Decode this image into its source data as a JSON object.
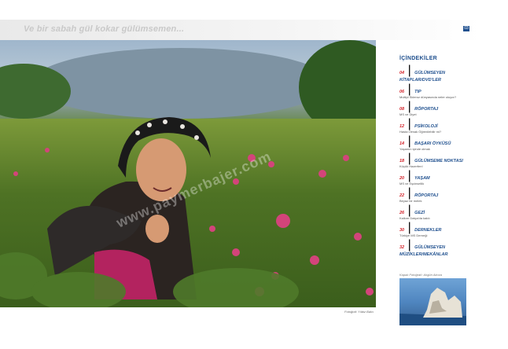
{
  "banner": {
    "title": "Ve bir sabah gül kokar gülümsemen..."
  },
  "page_number": "03",
  "photo": {
    "caption": "Fotoğraf: Yıldız Balcı",
    "watermark": "www.paymerbajer.com"
  },
  "toc": {
    "heading": "İÇİNDEKİLER",
    "items": [
      {
        "num": "04",
        "title": "GÜLÜMSEYEN KİTAPLAR/DVD'LER",
        "sub": ""
      },
      {
        "num": "06",
        "title": "TIP",
        "sub": "Multipl Skleroz dünyasında neler oluyor?"
      },
      {
        "num": "08",
        "title": "RÖPORTAJ",
        "sub": "MS ve Diyet"
      },
      {
        "num": "12",
        "title": "PSİKOLOJİ",
        "sub": "Hasta Olmak Öğrenilebilir mi?"
      },
      {
        "num": "14",
        "title": "BAŞARI ÖYKÜSÜ",
        "sub": "Yaşamın içinde olmak"
      },
      {
        "num": "18",
        "title": "GÜLÜMSEME NOKTASI",
        "sub": "Küçük Hazerfen!"
      },
      {
        "num": "20",
        "title": "YAŞAM",
        "sub": "MS ve Eşcinsellik"
      },
      {
        "num": "22",
        "title": "RÖPORTAJ",
        "sub": "Beyaz bir melek"
      },
      {
        "num": "26",
        "title": "GEZİ",
        "sub": "Kalkım Datça'da kaldı"
      },
      {
        "num": "30",
        "title": "DERNEKLER",
        "sub": "Türkiye MS Derneği"
      },
      {
        "num": "32",
        "title": "GÜLÜMSEYEN MÜZİKLER/MEKÂNLAR",
        "sub": ""
      }
    ],
    "cover_caption": "Kapak Fotoğrafı: Akgün Akova"
  }
}
